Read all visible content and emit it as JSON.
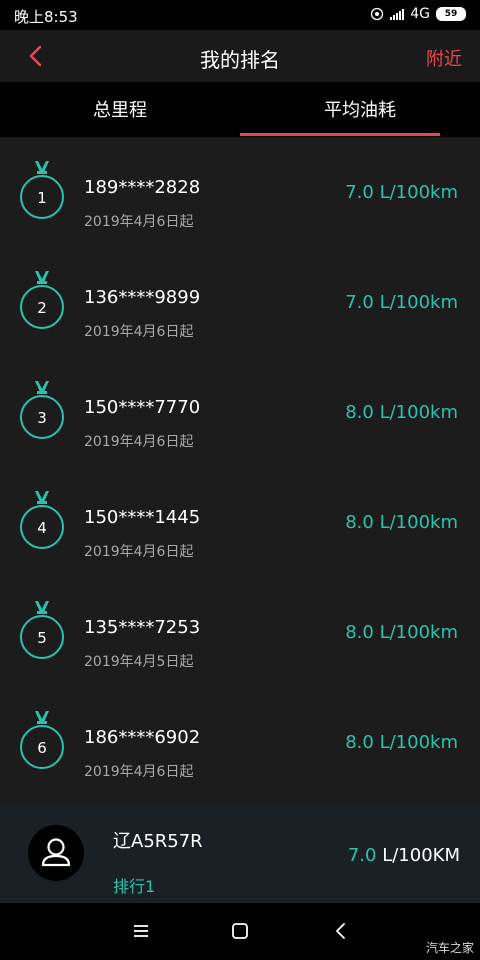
{
  "status_bar": {
    "time": "晚上8:53",
    "network": "4G",
    "battery": "59"
  },
  "header": {
    "title": "我的排名",
    "nearby_label": "附近",
    "back_icon": "chevron-left-icon"
  },
  "tabs": [
    {
      "label": "总里程",
      "active": false
    },
    {
      "label": "平均油耗",
      "active": true
    }
  ],
  "rankings": [
    {
      "rank": "1",
      "phone": "189****2828",
      "since": "2019年4月6日起",
      "value": "7.0 L/100km"
    },
    {
      "rank": "2",
      "phone": "136****9899",
      "since": "2019年4月6日起",
      "value": "7.0 L/100km"
    },
    {
      "rank": "3",
      "phone": "150****7770",
      "since": "2019年4月6日起",
      "value": "8.0 L/100km"
    },
    {
      "rank": "4",
      "phone": "150****1445",
      "since": "2019年4月6日起",
      "value": "8.0 L/100km"
    },
    {
      "rank": "5",
      "phone": "135****7253",
      "since": "2019年4月5日起",
      "value": "8.0 L/100km"
    },
    {
      "rank": "6",
      "phone": "186****6902",
      "since": "2019年4月6日起",
      "value": "8.0 L/100km"
    }
  ],
  "my_rank": {
    "plate": "辽A5R57R",
    "rank_label": "排行1",
    "value_number": "7.0",
    "value_unit": " L/100KM"
  },
  "watermark": "汽车之家",
  "colors": {
    "accent_red": "#e8474f",
    "accent_teal": "#2bc3ae"
  }
}
